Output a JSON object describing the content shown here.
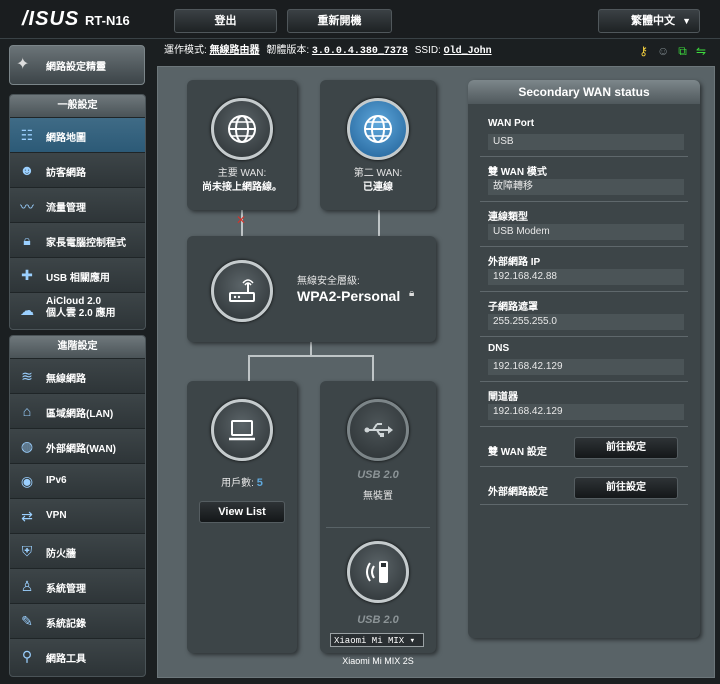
{
  "header": {
    "logo": "/ISUS",
    "model": "RT-N16",
    "logout_label": "登出",
    "reboot_label": "重新開機",
    "language": "繁體中文"
  },
  "infobar": {
    "mode_label": "運作模式:",
    "mode_value": "無線路由器",
    "firmware_label": "韌體版本:",
    "firmware_value": "3.0.0.4.380_7378",
    "ssid_label": "SSID:",
    "ssid_value": "Old_John"
  },
  "sidebar": {
    "wizard_label": "網路設定精靈",
    "general_header": "一般設定",
    "general_items": [
      {
        "label": "網路地圖"
      },
      {
        "label": "訪客網路"
      },
      {
        "label": "流量管理"
      },
      {
        "label": "家長電腦控制程式"
      },
      {
        "label": "USB 相關應用"
      },
      {
        "label": "AiCloud 2.0",
        "label2": "個人雲 2.0 應用"
      }
    ],
    "advanced_header": "進階設定",
    "advanced_items": [
      {
        "label": "無線網路"
      },
      {
        "label": "區域網路(LAN)"
      },
      {
        "label": "外部網路(WAN)"
      },
      {
        "label": "IPv6"
      },
      {
        "label": "VPN"
      },
      {
        "label": "防火牆"
      },
      {
        "label": "系統管理"
      },
      {
        "label": "系統記錄"
      },
      {
        "label": "網路工具"
      }
    ]
  },
  "map": {
    "primary_wan_label": "主要 WAN:",
    "primary_wan_status": "尚未接上網路線。",
    "secondary_wan_label": "第二 WAN:",
    "secondary_wan_status": "已連線",
    "security_label": "無線安全層級:",
    "security_value": "WPA2-Personal",
    "clients_label": "用戶數:",
    "clients_count": "5",
    "view_list_label": "View List",
    "usb1_label": "USB 2.0",
    "usb1_status": "無裝置",
    "usb2_label": "USB 2.0",
    "usb2_device_select": "Xiaomi Mi MIX ▾",
    "usb2_device_name": "Xiaomi Mi MIX 2S"
  },
  "wan_status": {
    "title": "Secondary WAN status",
    "fields": [
      {
        "label": "WAN Port",
        "value": "USB"
      },
      {
        "label": "雙 WAN 模式",
        "value": "故障轉移"
      },
      {
        "label": "連線類型",
        "value": "USB Modem"
      },
      {
        "label": "外部網路 IP",
        "value": "192.168.42.88"
      },
      {
        "label": "子網路遮罩",
        "value": "255.255.255.0"
      },
      {
        "label": "DNS",
        "value": "192.168.42.129"
      },
      {
        "label": "閘道器",
        "value": "192.168.42.129"
      }
    ],
    "dual_wan_label": "雙 WAN 設定",
    "dual_wan_button": "前往設定",
    "wan_settings_label": "外部網路設定",
    "wan_settings_button": "前往設定"
  },
  "colors": {
    "background": "#1b1f21",
    "card": "#3d4548",
    "map_bg": "#596367",
    "accent_blue": "#5fa8dc",
    "status_yellow": "#f4d03f",
    "status_green": "#3ddc3d"
  }
}
